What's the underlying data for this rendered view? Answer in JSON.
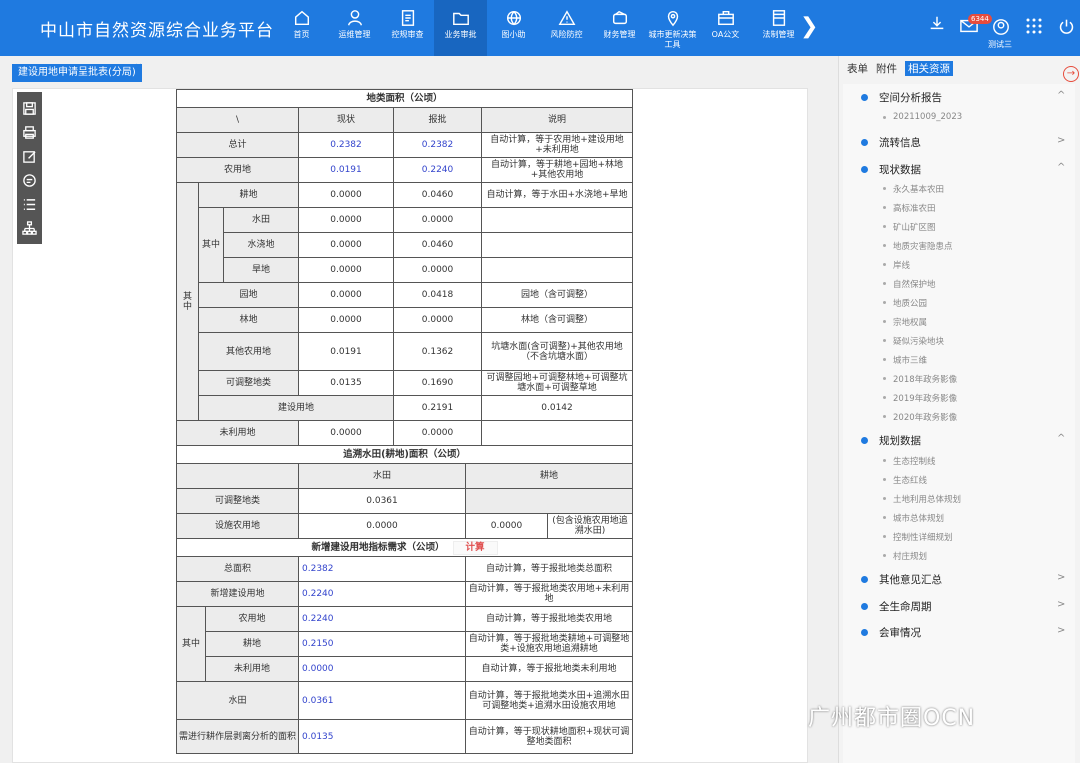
{
  "app": {
    "title": "中山市自然资源综合业务平台",
    "username": "测试三",
    "mail_badge": "6344"
  },
  "nav": [
    {
      "label": "首页",
      "icon": "home-icon"
    },
    {
      "label": "运维管理",
      "icon": "user-icon"
    },
    {
      "label": "控规审查",
      "icon": "document-icon"
    },
    {
      "label": "业务审批",
      "icon": "folder-icon",
      "active": true
    },
    {
      "label": "图小助",
      "icon": "globe-icon"
    },
    {
      "label": "风险防控",
      "icon": "warning-icon"
    },
    {
      "label": "财务管理",
      "icon": "wallet-icon"
    },
    {
      "label": "城市更新决策工具",
      "icon": "location-icon"
    },
    {
      "label": "OA公文",
      "icon": "briefcase-icon"
    },
    {
      "label": "法制管理",
      "icon": "book-icon"
    }
  ],
  "doc_tab": {
    "label": "建设用地申请呈批表(分局)",
    "close": "×"
  },
  "form": {
    "land_title": "地类面积（公顷）",
    "col_backslash": "\\",
    "col_current": "现状",
    "col_approve": "报批",
    "col_note": "说明",
    "qizhong": "其中",
    "rows": [
      {
        "label": "总计",
        "current": "0.2382",
        "approve": "0.2382",
        "note": "自动计算，等于农用地+建设用地+未利用地"
      },
      {
        "label": "农用地",
        "current": "0.0191",
        "approve": "0.2240",
        "note": "自动计算，等于耕地+园地+林地+其他农用地"
      },
      {
        "label": "耕地",
        "current": "0.0000",
        "approve": "0.0460",
        "note": "自动计算，等于水田+水浇地+旱地"
      },
      {
        "label": "水田",
        "current": "0.0000",
        "approve": "0.0000",
        "note": ""
      },
      {
        "label": "水浇地",
        "current": "0.0000",
        "approve": "0.0460",
        "note": ""
      },
      {
        "label": "旱地",
        "current": "0.0000",
        "approve": "0.0000",
        "note": ""
      },
      {
        "label": "园地",
        "current": "0.0000",
        "approve": "0.0418",
        "note": "园地（含可调整）"
      },
      {
        "label": "林地",
        "current": "0.0000",
        "approve": "0.0000",
        "note": "林地（含可调整）"
      },
      {
        "label": "其他农用地",
        "current": "0.0191",
        "approve": "0.1362",
        "note": "坑塘水面(含可调整)+其他农用地（不含坑塘水面）"
      },
      {
        "label": "可调整地类",
        "current": "0.0135",
        "approve": "0.1690",
        "note": "可调整园地+可调整林地+可调整坑塘水面+可调整草地"
      },
      {
        "label": "建设用地",
        "current": "0.2191",
        "approve": "0.0142",
        "note": ""
      },
      {
        "label": "未利用地",
        "current": "0.0000",
        "approve": "0.0000",
        "note": ""
      }
    ],
    "trace_title": "追溯水田(耕地)面积（公顷）",
    "trace_col_paddy": "水田",
    "trace_col_arable": "耕地",
    "trace_rows": [
      {
        "label": "可调整地类",
        "paddy": "0.0361",
        "arable": "",
        "arable_note": ""
      },
      {
        "label": "设施农用地",
        "paddy": "0.0000",
        "arable": "0.0000",
        "arable_note": "(包含设施农用地追溯水田)"
      }
    ],
    "new_title": "新增建设用地指标需求（公顷）",
    "calc_label": "计算",
    "new_rows": [
      {
        "label": "总面积",
        "value": "0.2382",
        "note": "自动计算，等于报批地类总面积"
      },
      {
        "label": "新增建设用地",
        "value": "0.2240",
        "note": "自动计算，等于报批地类农用地+未利用地"
      },
      {
        "label": "农用地",
        "value": "0.2240",
        "note": "自动计算，等于报批地类农用地"
      },
      {
        "label": "耕地",
        "value": "0.2150",
        "note": "自动计算，等于报批地类耕地+可调整地类+设施农用地追溯耕地"
      },
      {
        "label": "未利用地",
        "value": "0.0000",
        "note": "自动计算，等于报批地类未利用地"
      },
      {
        "label": "水田",
        "value": "0.0361",
        "note": "自动计算，等于报批地类水田+追溯水田可调整地类+追溯水田设施农用地"
      },
      {
        "label": "需进行耕作层剥离分析的面积",
        "value": "0.0135",
        "note": "自动计算，等于现状耕地面积+现状可调整地类面积"
      }
    ]
  },
  "right_panel": {
    "tabs": [
      "表单",
      "附件",
      "相关资源"
    ],
    "close": "→",
    "groups": [
      {
        "label": "空间分析报告",
        "chev": "^",
        "items": [
          "20211009_2023"
        ]
      },
      {
        "label": "流转信息",
        "chev": ">",
        "items": []
      },
      {
        "label": "现状数据",
        "chev": "^",
        "items": [
          "永久基本农田",
          "高标准农田",
          "矿山矿区图",
          "地质灾害隐患点",
          "岸线",
          "自然保护地",
          "地质公园",
          "宗地权属",
          "疑似污染地块",
          "城市三维",
          "2018年政务影像",
          "2019年政务影像",
          "2020年政务影像"
        ]
      },
      {
        "label": "规划数据",
        "chev": "^",
        "items": [
          "生态控制线",
          "生态红线",
          "土地利用总体规划",
          "城市总体规划",
          "控制性详细规划",
          "村庄规划"
        ]
      },
      {
        "label": "其他意见汇总",
        "chev": ">",
        "items": []
      },
      {
        "label": "全生命周期",
        "chev": ">",
        "items": []
      },
      {
        "label": "会审情况",
        "chev": ">",
        "items": []
      }
    ]
  },
  "watermark": "广州都市圈OCN"
}
